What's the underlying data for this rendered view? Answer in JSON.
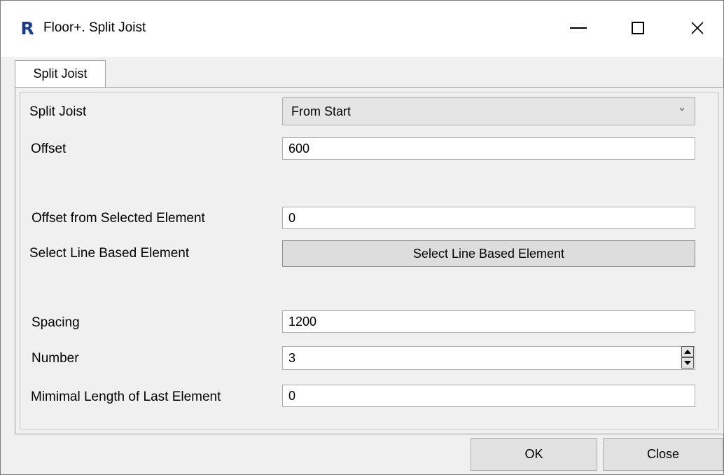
{
  "window": {
    "title": "Floor+. Split Joist",
    "app_icon_letter": "R",
    "icons": [
      "revit-app-icon",
      "minimize-icon",
      "maximize-icon",
      "close-icon"
    ]
  },
  "tab": {
    "label": "Split Joist"
  },
  "form": {
    "split_joist": {
      "label": "Split Joist",
      "value": "From Start"
    },
    "offset": {
      "label": "Offset",
      "value": "600"
    },
    "offset_from_selected": {
      "label": "Offset from Selected Element",
      "value": "0"
    },
    "select_line": {
      "label": "Select Line Based Element",
      "button_label": "Select Line Based Element"
    },
    "spacing": {
      "label": "Spacing",
      "value": "1200"
    },
    "number": {
      "label": "Number",
      "value": "3"
    },
    "min_length": {
      "label": "Mimimal Length of Last Element",
      "value": "0"
    }
  },
  "buttons": {
    "ok": "OK",
    "close": "Close"
  },
  "colors": {
    "app_icon": "#1b3c8c",
    "window_bg": "#f0f0f0",
    "titlebar_bg": "#ffffff"
  }
}
